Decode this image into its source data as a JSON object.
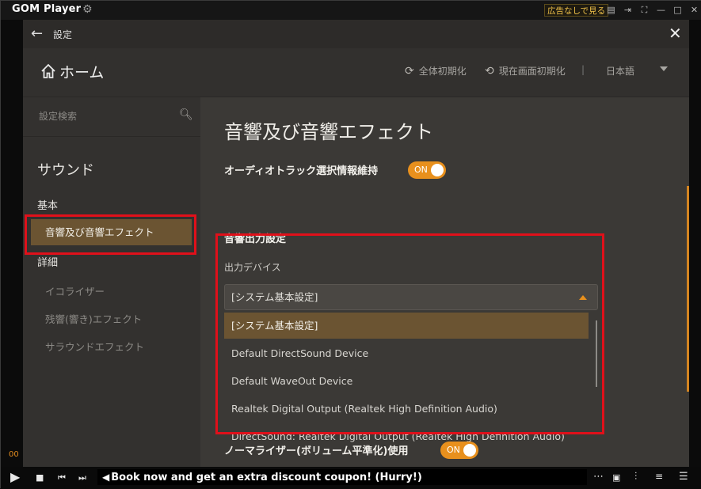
{
  "player": {
    "logo": "GOM Player",
    "ad_free_label": "広告なしで見る",
    "titlebar_icons": [
      "mini-mode-icon",
      "pip-icon",
      "fullscreen-icon",
      "minimize-icon",
      "maximize-icon",
      "close-icon"
    ],
    "time_left": "00",
    "ticker_text": "Book now and get an extra discount coupon! (Hurry!)"
  },
  "settings": {
    "window_title": "設定",
    "home_label": "ホーム",
    "reset_all": "全体初期化",
    "reset_current": "現在画面初期化",
    "divider": "|",
    "language": "日本語",
    "search_placeholder": "設定検索",
    "sidebar": {
      "section": "サウンド",
      "basic": "基本",
      "active_item": "音響及び音響エフェクト",
      "detail": "詳細",
      "sub_items": [
        "イコライザー",
        "残響(響き)エフェクト",
        "サラウンドエフェクト"
      ]
    },
    "content": {
      "title": "音響及び音響エフェクト",
      "audio_track_label": "オーディオトラック選択情報維持",
      "audio_track_toggle": "ON",
      "output_heading": "音響出力設定",
      "device_label": "出力デバイス",
      "device_selected": "[システム基本設定]",
      "device_options": [
        "[システム基本設定]",
        "Default DirectSound Device",
        "Default WaveOut Device",
        "Realtek Digital Output (Realtek High Definition Audio)",
        "DirectSound: Realtek Digital Output (Realtek High Definition Audio)"
      ],
      "normalizer_label": "ノーマライザー(ボリューム平準化)使用",
      "normalizer_toggle": "ON"
    }
  },
  "colors": {
    "accent": "#e8901d",
    "selected_bg": "#6b5432",
    "highlight_box": "#e0101a"
  }
}
